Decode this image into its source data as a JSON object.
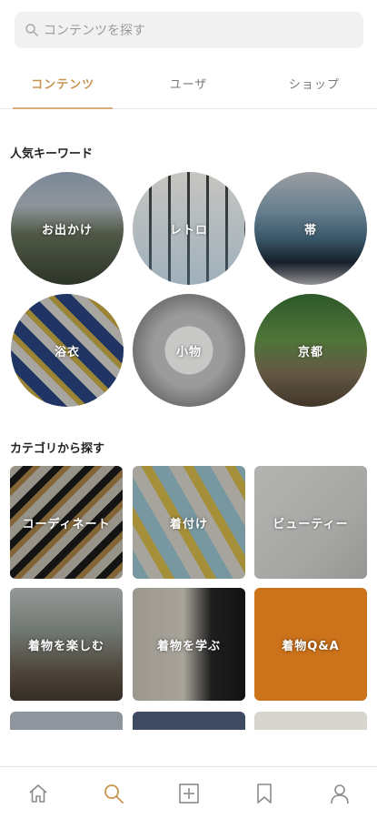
{
  "search": {
    "placeholder": "コンテンツを探す"
  },
  "tabs": [
    {
      "label": "コンテンツ",
      "active": true
    },
    {
      "label": "ユーザ",
      "active": false
    },
    {
      "label": "ショップ",
      "active": false
    }
  ],
  "keywords_section": {
    "title": "人気キーワード",
    "items": [
      {
        "label": "お出かけ"
      },
      {
        "label": "レトロ"
      },
      {
        "label": "帯"
      },
      {
        "label": "浴衣"
      },
      {
        "label": "小物"
      },
      {
        "label": "京都"
      }
    ]
  },
  "category_section": {
    "title": "カテゴリから探す",
    "items": [
      {
        "label": "コーディネート"
      },
      {
        "label": "着付け"
      },
      {
        "label": "ビューティー"
      },
      {
        "label": "着物を楽しむ"
      },
      {
        "label": "着物を学ぶ"
      },
      {
        "label": "着物Q&A"
      }
    ]
  },
  "bottom_nav": {
    "items": [
      {
        "icon": "home-icon",
        "active": false
      },
      {
        "icon": "search-icon",
        "active": true
      },
      {
        "icon": "plus-box-icon",
        "active": false
      },
      {
        "icon": "bookmark-icon",
        "active": false
      },
      {
        "icon": "user-icon",
        "active": false
      }
    ]
  },
  "colors": {
    "accent": "#c8944f"
  }
}
